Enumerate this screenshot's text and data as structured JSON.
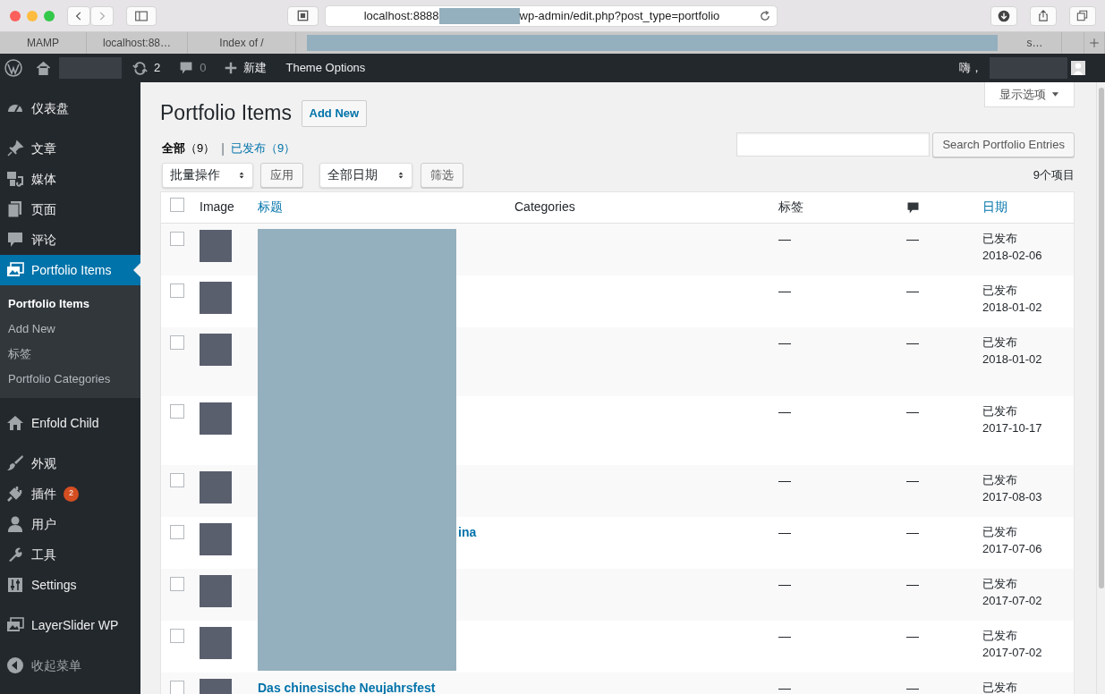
{
  "browser": {
    "address_start": "localhost:8888",
    "address_end": "wp-admin/edit.php?post_type=portfolio",
    "tabs_before": [
      {
        "label": "MAMP"
      },
      {
        "label": "localhost:88…"
      },
      {
        "label": "Index of /"
      }
    ],
    "tabs_after": [
      {
        "label": "s…"
      }
    ]
  },
  "admin_bar": {
    "updates": "2",
    "comments": "0",
    "new_label": "新建",
    "theme_options": "Theme Options",
    "greeting": "嗨，"
  },
  "sidebar": {
    "sections": [
      [
        {
          "label": "仪表盘",
          "selected": false
        }
      ],
      [
        {
          "label": "文章",
          "selected": false
        },
        {
          "label": "媒体",
          "selected": false
        },
        {
          "label": "页面",
          "selected": false
        },
        {
          "label": "评论",
          "selected": false
        },
        {
          "label": "Portfolio Items",
          "selected": true,
          "children": [
            {
              "label": "Portfolio Items",
              "selected": true
            },
            {
              "label": "Add New",
              "selected": false
            },
            {
              "label": "标签",
              "selected": false
            },
            {
              "label": "Portfolio Categories",
              "selected": false
            }
          ]
        }
      ],
      [
        {
          "label": "Enfold Child",
          "selected": false
        }
      ],
      [
        {
          "label": "外观",
          "selected": false
        },
        {
          "label": "插件",
          "selected": false,
          "badge": "2"
        },
        {
          "label": "用户",
          "selected": false
        },
        {
          "label": "工具",
          "selected": false
        },
        {
          "label": "Settings",
          "selected": false
        }
      ],
      [
        {
          "label": "LayerSlider WP",
          "selected": false
        }
      ],
      [
        {
          "label": "收起菜单",
          "selected": false,
          "kind": "collapse"
        }
      ]
    ]
  },
  "page": {
    "title": "Portfolio Items",
    "add_new": "Add New",
    "screen_options": "显示选项",
    "views_separator": "|",
    "views": [
      {
        "label": "全部",
        "count": "（9）",
        "selected": true
      },
      {
        "label": "已发布",
        "count": "（9）",
        "selected": false
      }
    ],
    "search_button": "Search Portfolio Entries",
    "bulk_action": "批量操作",
    "apply": "应用",
    "date_filter": "全部日期",
    "filter": "筛选",
    "item_count": "9个项目"
  },
  "table": {
    "select_all_checked": false,
    "columns": [
      "Image",
      "标题",
      "Categories",
      "标签",
      "日期"
    ],
    "rows": [
      {
        "checked": false,
        "tags": "—",
        "comments": "—",
        "status": "已发布",
        "date": "2018-02-06",
        "tall": false
      },
      {
        "checked": false,
        "tags": "—",
        "comments": "—",
        "status": "已发布",
        "date": "2018-01-02",
        "tall": false
      },
      {
        "checked": false,
        "tags": "—",
        "comments": "—",
        "status": "已发布",
        "date": "2018-01-02",
        "tall": true
      },
      {
        "checked": false,
        "tags": "—",
        "comments": "—",
        "status": "已发布",
        "date": "2017-10-17",
        "tall": true
      },
      {
        "checked": false,
        "tags": "—",
        "comments": "—",
        "status": "已发布",
        "date": "2017-08-03",
        "tall": false
      },
      {
        "checked": false,
        "title": "ina",
        "tags": "—",
        "comments": "—",
        "status": "已发布",
        "date": "2017-07-06",
        "tall": false
      },
      {
        "checked": false,
        "tags": "—",
        "comments": "—",
        "status": "已发布",
        "date": "2017-07-02",
        "tall": false
      },
      {
        "checked": false,
        "tags": "—",
        "comments": "—",
        "status": "已发布",
        "date": "2017-07-02",
        "tall": false
      },
      {
        "checked": false,
        "title": "Das chinesische Neujahrsfest",
        "tags": "—",
        "comments": "—",
        "status": "已发布",
        "tall": false
      }
    ]
  }
}
